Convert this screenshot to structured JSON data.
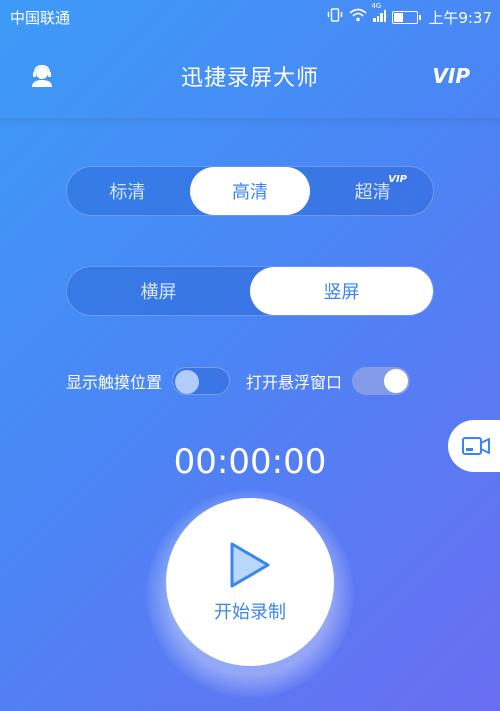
{
  "status_bar": {
    "carrier": "中国联通",
    "network_label": "4G",
    "time": "上午9:37"
  },
  "header": {
    "title": "迅捷录屏大师",
    "vip_label": "VIP"
  },
  "quality": {
    "options": [
      "标清",
      "高清",
      "超清"
    ],
    "selected": "高清",
    "vip_badge": "VIP"
  },
  "orientation": {
    "options": [
      "横屏",
      "竖屏"
    ],
    "selected": "竖屏"
  },
  "toggles": [
    {
      "label": "显示触摸位置",
      "on": false
    },
    {
      "label": "打开悬浮窗口",
      "on": true
    }
  ],
  "timer": "00:00:00",
  "record": {
    "label": "开始录制"
  },
  "colors": {
    "accent": "#3a86f0",
    "gradient_start": "#3d9bf7",
    "gradient_end": "#6a6ef2"
  },
  "icons": {
    "support": "headset-user-icon",
    "float": "video-camera-icon",
    "record": "play-icon"
  }
}
